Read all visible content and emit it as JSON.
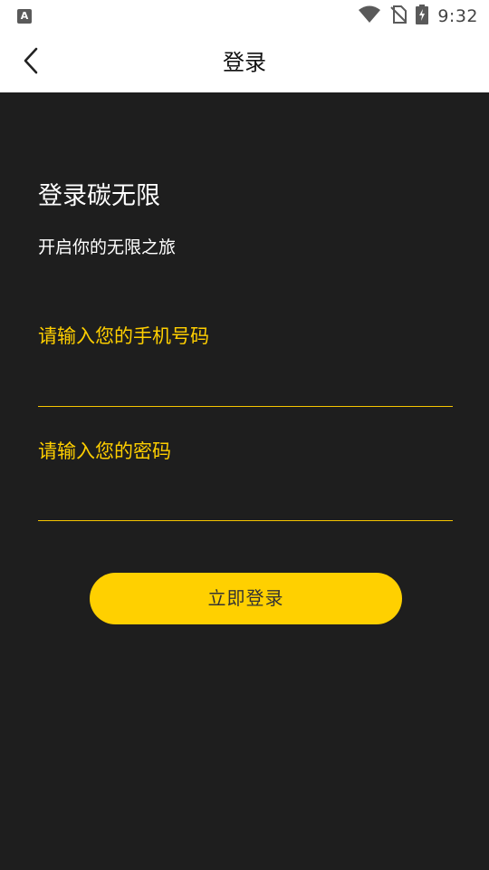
{
  "status_bar": {
    "left_icon": "text-a-icon",
    "left_icon_glyph": "A",
    "icons": [
      "wifi-icon",
      "no-sim-icon",
      "battery-charging-icon"
    ],
    "time": "9:32"
  },
  "app_bar": {
    "back_icon": "chevron-left-icon",
    "title": "登录"
  },
  "welcome": {
    "title": "登录碳无限",
    "subtitle": "开启你的无限之旅"
  },
  "form": {
    "phone_placeholder": "请输入您的手机号码",
    "phone_value": "",
    "password_placeholder": "请输入您的密码",
    "password_value": "",
    "submit_label": "立即登录"
  },
  "colors": {
    "accent": "#ffd000",
    "input_text": "#ffcf00",
    "background": "#1e1e1e",
    "app_bar": "#ffffff"
  }
}
